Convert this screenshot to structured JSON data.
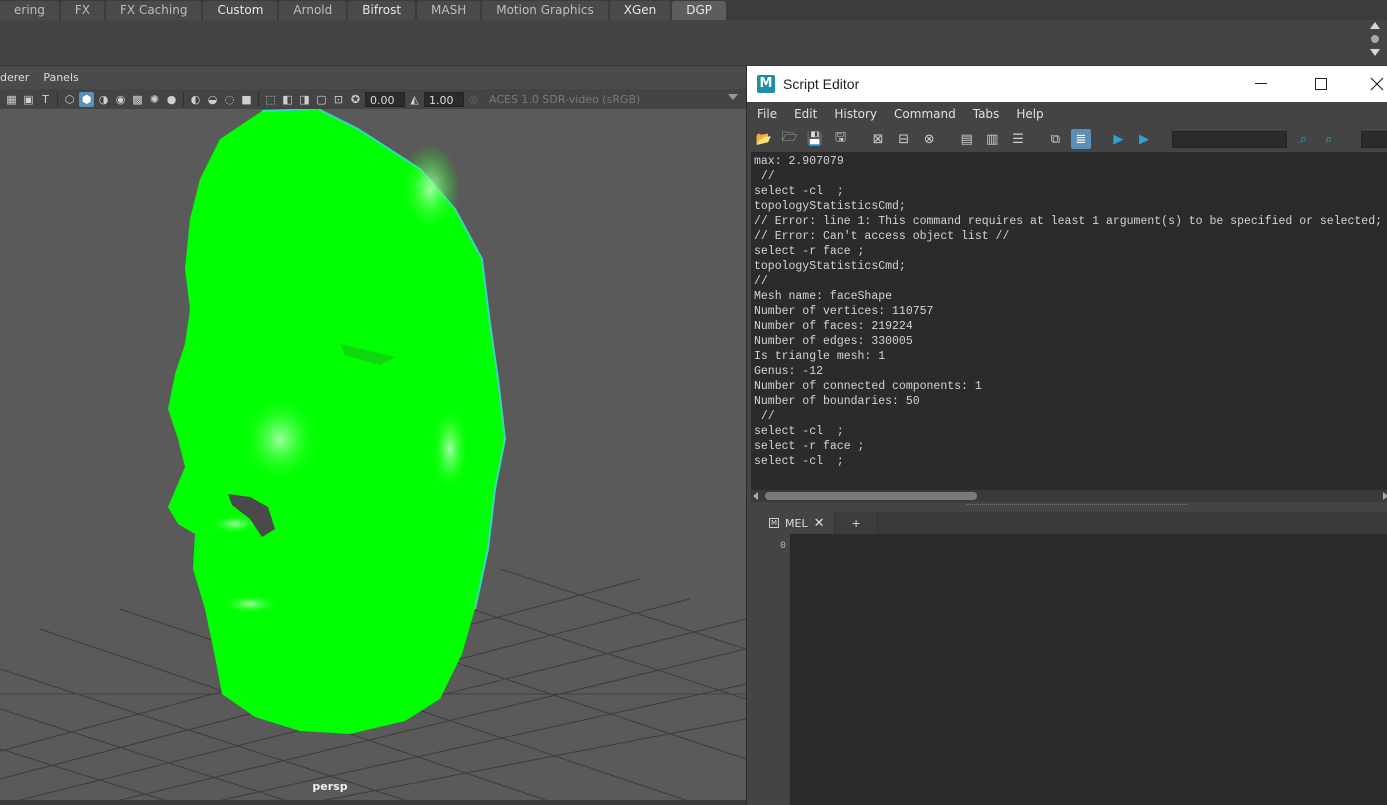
{
  "shelf": {
    "tabs": [
      {
        "label": "ering"
      },
      {
        "label": "FX"
      },
      {
        "label": "FX Caching"
      },
      {
        "label": "Custom"
      },
      {
        "label": "Arnold"
      },
      {
        "label": "Bifrost"
      },
      {
        "label": "MASH"
      },
      {
        "label": "Motion Graphics"
      },
      {
        "label": "XGen"
      },
      {
        "label": "DGP"
      }
    ],
    "active_tab": "DGP"
  },
  "viewport": {
    "menu": [
      "derer",
      "Panels"
    ],
    "exposure": "0.00",
    "gamma": "1.00",
    "color_space": "ACES 1.0 SDR-video (sRGB)",
    "camera": "persp",
    "mesh_color": "#00ff00",
    "background": "#5a5a5a"
  },
  "script_editor": {
    "title": "Script Editor",
    "menu": [
      "File",
      "Edit",
      "History",
      "Command",
      "Tabs",
      "Help"
    ],
    "history": [
      "max: 2.907079",
      " //",
      "select -cl  ;",
      "topologyStatisticsCmd;",
      "// Error: line 1: This command requires at least 1 argument(s) to be specified or selected;",
      "// Error: Can't access object list //",
      "select -r face ;",
      "topologyStatisticsCmd;",
      "//",
      "Mesh name: faceShape",
      "Number of vertices: 110757",
      "Number of faces: 219224",
      "Number of edges: 330005",
      "Is triangle mesh: 1",
      "Genus: -12",
      "Number of connected components: 1",
      "Number of boundaries: 50",
      " //",
      "select -cl  ;",
      "select -r face ;",
      "select -cl  ;"
    ],
    "tabs": [
      {
        "label": "MEL"
      },
      {
        "label": "+"
      }
    ],
    "line_number": "0"
  }
}
